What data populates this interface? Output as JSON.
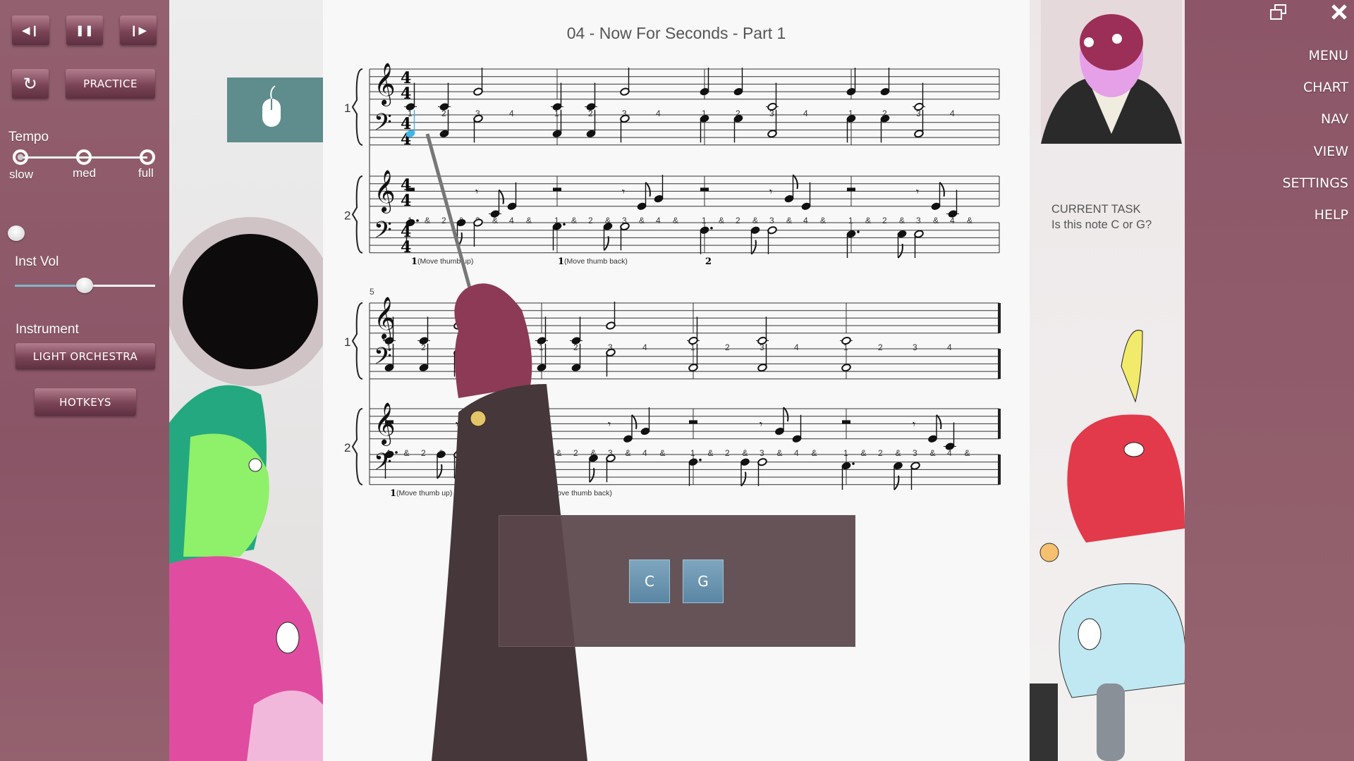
{
  "left_panel": {
    "transport": {
      "rewind_icon": "skip-back-icon",
      "pause_icon": "pause-icon",
      "forward_icon": "skip-forward-icon"
    },
    "restart_icon": "restart-icon",
    "practice_label": "PRACTICE",
    "tempo": {
      "label": "Tempo",
      "options": [
        "slow",
        "med",
        "full"
      ],
      "selected": "slow"
    },
    "inst_vol": {
      "label": "Inst Vol",
      "value_percent": 50
    },
    "instrument": {
      "label": "Instrument",
      "value": "LIGHT ORCHESTRA"
    },
    "hotkeys_label": "HOTKEYS",
    "accent": "#8d5a6a"
  },
  "scene": {
    "hint_icon": "mouse-icon",
    "hint_color": "#5f8c8c"
  },
  "score": {
    "title": "04 - Now For Seconds - Part 1",
    "measure_number_system2": "5",
    "highlight_color": "#3fb6e8",
    "parts": [
      {
        "label": "1",
        "counts": [
          "1",
          "2",
          "3",
          "4"
        ],
        "treble": [
          [
            [
              0,
              -2,
              "q"
            ],
            [
              1,
              -2,
              "q"
            ],
            [
              2,
              2,
              "h"
            ]
          ],
          [
            [
              0,
              -2,
              "q"
            ],
            [
              1,
              -2,
              "q"
            ],
            [
              2,
              2,
              "h"
            ]
          ],
          [
            [
              0,
              2,
              "q"
            ],
            [
              1,
              2,
              "q"
            ],
            [
              2,
              -2,
              "h"
            ]
          ],
          [
            [
              0,
              2,
              "q"
            ],
            [
              1,
              2,
              "q"
            ],
            [
              2,
              -2,
              "h"
            ]
          ],
          [
            [
              0,
              -2,
              "q"
            ],
            [
              1,
              -2,
              "q"
            ],
            [
              2,
              2,
              "h"
            ]
          ],
          [
            [
              0,
              -2,
              "q"
            ],
            [
              1,
              -2,
              "q"
            ],
            [
              2,
              2,
              "h"
            ]
          ],
          [
            [
              0,
              -2,
              "h"
            ],
            [
              2,
              -2,
              "h"
            ]
          ],
          [
            [
              0,
              -2,
              "w"
            ]
          ]
        ],
        "bass": [
          [
            [
              0,
              3,
              "q"
            ],
            [
              1,
              3,
              "q"
            ],
            [
              2,
              7,
              "h"
            ]
          ],
          [
            [
              0,
              3,
              "q"
            ],
            [
              1,
              3,
              "q"
            ],
            [
              2,
              7,
              "h"
            ]
          ],
          [
            [
              0,
              7,
              "q"
            ],
            [
              1,
              7,
              "q"
            ],
            [
              2,
              3,
              "h"
            ]
          ],
          [
            [
              0,
              7,
              "q"
            ],
            [
              1,
              7,
              "q"
            ],
            [
              2,
              3,
              "h"
            ]
          ],
          [
            [
              0,
              3,
              "q"
            ],
            [
              1,
              3,
              "q"
            ],
            [
              2,
              7,
              "h"
            ]
          ],
          [
            [
              0,
              3,
              "q"
            ],
            [
              1,
              3,
              "q"
            ],
            [
              2,
              7,
              "h"
            ]
          ],
          [
            [
              0,
              3,
              "h"
            ],
            [
              2,
              3,
              "h"
            ]
          ],
          [
            [
              0,
              3,
              "w"
            ]
          ]
        ],
        "highlighted_note": {
          "staff": "bass",
          "measure": 1,
          "index": 0
        }
      },
      {
        "label": "2",
        "counts": [
          "1",
          "&",
          "2",
          "&",
          "3",
          "&",
          "4",
          "&"
        ],
        "treble": [
          [
            [
              0,
              4,
              "r2"
            ],
            [
              2,
              4,
              "r8"
            ],
            [
              2.5,
              -2,
              "e"
            ],
            [
              3,
              0,
              "q"
            ]
          ],
          [
            [
              0,
              4,
              "r2"
            ],
            [
              2,
              4,
              "r8"
            ],
            [
              2.5,
              0,
              "e"
            ],
            [
              3,
              2,
              "q"
            ]
          ],
          [
            [
              0,
              4,
              "r2"
            ],
            [
              2,
              4,
              "r8"
            ],
            [
              2.5,
              2,
              "e"
            ],
            [
              3,
              0,
              "q"
            ]
          ],
          [
            [
              0,
              4,
              "r2"
            ],
            [
              2,
              4,
              "r8"
            ],
            [
              2.5,
              0,
              "e"
            ],
            [
              3,
              -2,
              "q"
            ]
          ],
          [
            [
              0,
              4,
              "r2"
            ],
            [
              2,
              4,
              "r8"
            ],
            [
              2.5,
              -2,
              "e"
            ],
            [
              3,
              0,
              "q"
            ]
          ],
          [
            [
              0,
              4,
              "r2"
            ],
            [
              2,
              4,
              "r8"
            ],
            [
              2.5,
              0,
              "e"
            ],
            [
              3,
              2,
              "q"
            ]
          ],
          [
            [
              0,
              4,
              "r2"
            ],
            [
              2,
              4,
              "r8"
            ],
            [
              2.5,
              2,
              "e"
            ],
            [
              3,
              0,
              "q"
            ]
          ],
          [
            [
              0,
              4,
              "r2"
            ],
            [
              2,
              4,
              "r8"
            ],
            [
              2.5,
              0,
              "e"
            ],
            [
              3,
              -2,
              "q"
            ]
          ]
        ],
        "bass": [
          [
            [
              0,
              8,
              "qd"
            ],
            [
              1.5,
              8,
              "e"
            ],
            [
              2,
              8,
              "h"
            ]
          ],
          [
            [
              0,
              7,
              "qd"
            ],
            [
              1.5,
              7,
              "e"
            ],
            [
              2,
              7,
              "h"
            ]
          ],
          [
            [
              0,
              6,
              "qd"
            ],
            [
              1.5,
              6,
              "e"
            ],
            [
              2,
              6,
              "h"
            ]
          ],
          [
            [
              0,
              5,
              "qd"
            ],
            [
              1.5,
              5,
              "e"
            ],
            [
              2,
              5,
              "h"
            ]
          ],
          [
            [
              0,
              8,
              "qd"
            ],
            [
              1.5,
              8,
              "e"
            ],
            [
              2,
              8,
              "h"
            ]
          ],
          [
            [
              0,
              7,
              "qd"
            ],
            [
              1.5,
              7,
              "e"
            ],
            [
              2,
              7,
              "h"
            ]
          ],
          [
            [
              0,
              6,
              "qd"
            ],
            [
              1.5,
              6,
              "e"
            ],
            [
              2,
              6,
              "h"
            ]
          ],
          [
            [
              0,
              5,
              "qd"
            ],
            [
              1.5,
              5,
              "e"
            ],
            [
              2,
              5,
              "h"
            ]
          ]
        ],
        "annotations": [
          {
            "measure": 1,
            "finger": "1",
            "text": "(Move thumb up)"
          },
          {
            "measure": 2,
            "finger": "1",
            "text": "(Move thumb back)"
          },
          {
            "measure": 3,
            "finger": "2",
            "text": ""
          },
          {
            "measure": 5,
            "finger": "1",
            "text": "(Move thumb up)"
          },
          {
            "measure": 6,
            "finger": "",
            "text": "(Move thumb back)"
          }
        ]
      }
    ],
    "time_signature": [
      "4",
      "4"
    ]
  },
  "task": {
    "heading": "CURRENT TASK",
    "question": "Is this note C or G?"
  },
  "dialog": {
    "options": [
      "C",
      "G"
    ]
  },
  "right_panel": {
    "window_icons": [
      "restore-window-icon",
      "close-icon"
    ],
    "menu": [
      "MENU",
      "CHART",
      "NAV",
      "VIEW",
      "SETTINGS",
      "HELP"
    ]
  }
}
